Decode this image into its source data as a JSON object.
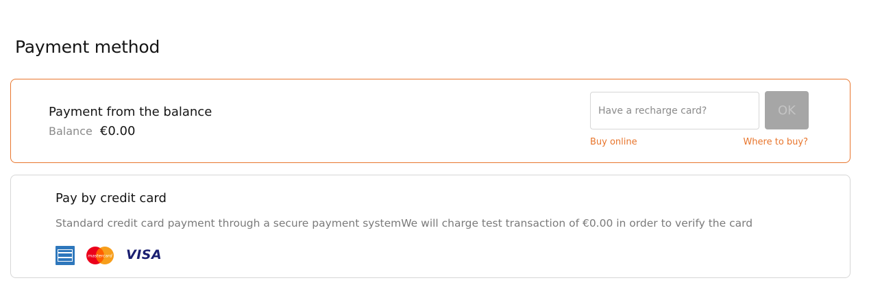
{
  "page": {
    "title": "Payment method"
  },
  "balance_option": {
    "title": "Payment from the balance",
    "balance_label": "Balance",
    "balance_value": "€0.00",
    "recharge_placeholder": "Have a recharge card?",
    "recharge_value": "",
    "ok_label": "OK",
    "ok_enabled": false,
    "buy_online_label": "Buy online",
    "where_to_buy_label": "Where to buy?"
  },
  "credit_option": {
    "title": "Pay by credit card",
    "description": "Standard credit card payment through a secure payment systemWe will charge test transaction of €0.00 in order to verify the card",
    "card_brands": [
      "amex-logo",
      "mastercard-logo",
      "visa-logo"
    ],
    "amex_text": "AMERICAN EXPRESS",
    "mastercard_text": "mastercard",
    "visa_text": "VISA"
  },
  "colors": {
    "accent": "#e8752c",
    "selected_border": "#e8752c",
    "card_border": "#d6d6d6",
    "ok_disabled_bg": "#a6a6a6",
    "text_primary": "#141414",
    "text_muted": "#7a7a7a"
  }
}
